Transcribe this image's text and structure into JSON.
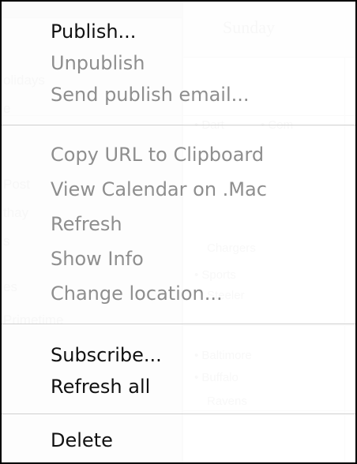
{
  "background_calendar": {
    "day_title": "Sunday",
    "sidebar_texts": [
      "olidays",
      "e",
      "Post",
      "thay",
      "s",
      "es",
      "Primetime"
    ],
    "events": [
      "• Dart",
      "• Com",
      "Chargers",
      "• Sports",
      "Steeler",
      "• Baltimore",
      "• Buffalo",
      "Ravens"
    ]
  },
  "menu": {
    "items": [
      {
        "label": "Publish...",
        "enabled": true
      },
      {
        "label": "Unpublish",
        "enabled": false
      },
      {
        "label": "Send publish email...",
        "enabled": false
      },
      {
        "label": "Copy URL to Clipboard",
        "enabled": false
      },
      {
        "label": "View Calendar on .Mac",
        "enabled": false
      },
      {
        "label": "Refresh",
        "enabled": false
      },
      {
        "label": "Show Info",
        "enabled": false
      },
      {
        "label": "Change location...",
        "enabled": false
      },
      {
        "label": "Subscribe...",
        "enabled": true
      },
      {
        "label": "Refresh all",
        "enabled": true
      },
      {
        "label": "Delete",
        "enabled": true
      }
    ]
  }
}
